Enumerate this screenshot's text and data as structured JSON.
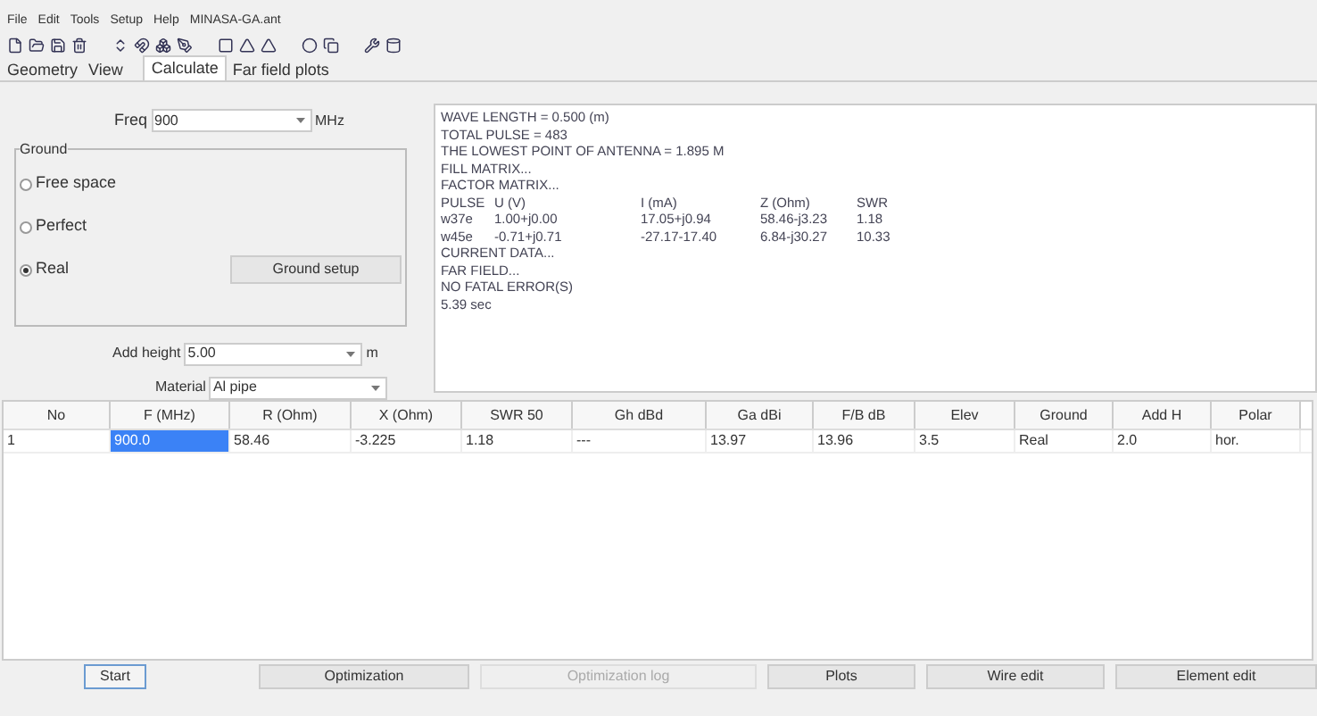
{
  "menu": [
    "File",
    "Edit",
    "Tools",
    "Setup",
    "Help",
    "MINASA-GA.ant"
  ],
  "tabs": [
    {
      "label": "Geometry",
      "selected": false
    },
    {
      "label": "View",
      "selected": false
    },
    {
      "label": "Calculate",
      "selected": true
    },
    {
      "label": "Far field plots",
      "selected": false
    }
  ],
  "freq": {
    "label": "Freq",
    "value": "900",
    "unit": "MHz"
  },
  "ground": {
    "title": "Ground",
    "options": [
      {
        "label": "Free space",
        "selected": false
      },
      {
        "label": "Perfect",
        "selected": false
      },
      {
        "label": "Real",
        "selected": true
      }
    ],
    "setup_button": "Ground setup"
  },
  "add_height": {
    "label": "Add height",
    "value": "5.00",
    "unit": "m"
  },
  "material": {
    "label": "Material",
    "value": "Al pipe"
  },
  "output": [
    {
      "kind": "text",
      "text": "WAVE LENGTH = 0.500 (m)"
    },
    {
      "kind": "text",
      "text": "TOTAL PULSE = 483"
    },
    {
      "kind": "text",
      "text": "THE LOWEST POINT OF ANTENNA = 1.895 M"
    },
    {
      "kind": "text",
      "text": "FILL MATRIX..."
    },
    {
      "kind": "text",
      "text": "FACTOR MATRIX..."
    },
    {
      "kind": "row",
      "cells": [
        "PULSE",
        "U (V)",
        "I (mA)",
        "Z (Ohm)",
        "SWR"
      ]
    },
    {
      "kind": "row",
      "cells": [
        "w37e",
        "1.00+j0.00",
        "17.05+j0.94",
        "58.46-j3.23",
        "1.18"
      ]
    },
    {
      "kind": "row",
      "cells": [
        "w45e",
        "-0.71+j0.71",
        "-27.17-17.40",
        "6.84-j30.27",
        "10.33"
      ]
    },
    {
      "kind": "text",
      "text": "CURRENT DATA..."
    },
    {
      "kind": "text",
      "text": "FAR FIELD..."
    },
    {
      "kind": "text",
      "text": "NO FATAL ERROR(S)"
    },
    {
      "kind": "text",
      "text": "5.39 sec"
    }
  ],
  "table": {
    "columns": [
      "No",
      "F (MHz)",
      "R (Ohm)",
      "X (Ohm)",
      "SWR 50",
      "Gh dBd",
      "Ga dBi",
      "F/B dB",
      "Elev",
      "Ground",
      "Add H",
      "Polar"
    ],
    "rows": [
      {
        "cells": [
          {
            "text": "1",
            "selected": false
          },
          {
            "text": "900.0",
            "selected": true
          },
          {
            "text": "58.46",
            "selected": false
          },
          {
            "text": "-3.225",
            "selected": false
          },
          {
            "text": "1.18",
            "selected": false
          },
          {
            "text": "---",
            "selected": false
          },
          {
            "text": "13.97",
            "selected": false
          },
          {
            "text": "13.96",
            "selected": false
          },
          {
            "text": "3.5",
            "selected": false
          },
          {
            "text": "Real",
            "selected": false
          },
          {
            "text": "2.0",
            "selected": false
          },
          {
            "text": "hor.",
            "selected": false
          }
        ]
      }
    ]
  },
  "buttons": [
    {
      "label": "Start",
      "disabled": false
    },
    {
      "label": "Optimization",
      "disabled": false
    },
    {
      "label": "Optimization log",
      "disabled": true
    },
    {
      "label": "Plots",
      "disabled": false
    },
    {
      "label": "Wire edit",
      "disabled": false
    },
    {
      "label": "Element edit",
      "disabled": false
    }
  ]
}
